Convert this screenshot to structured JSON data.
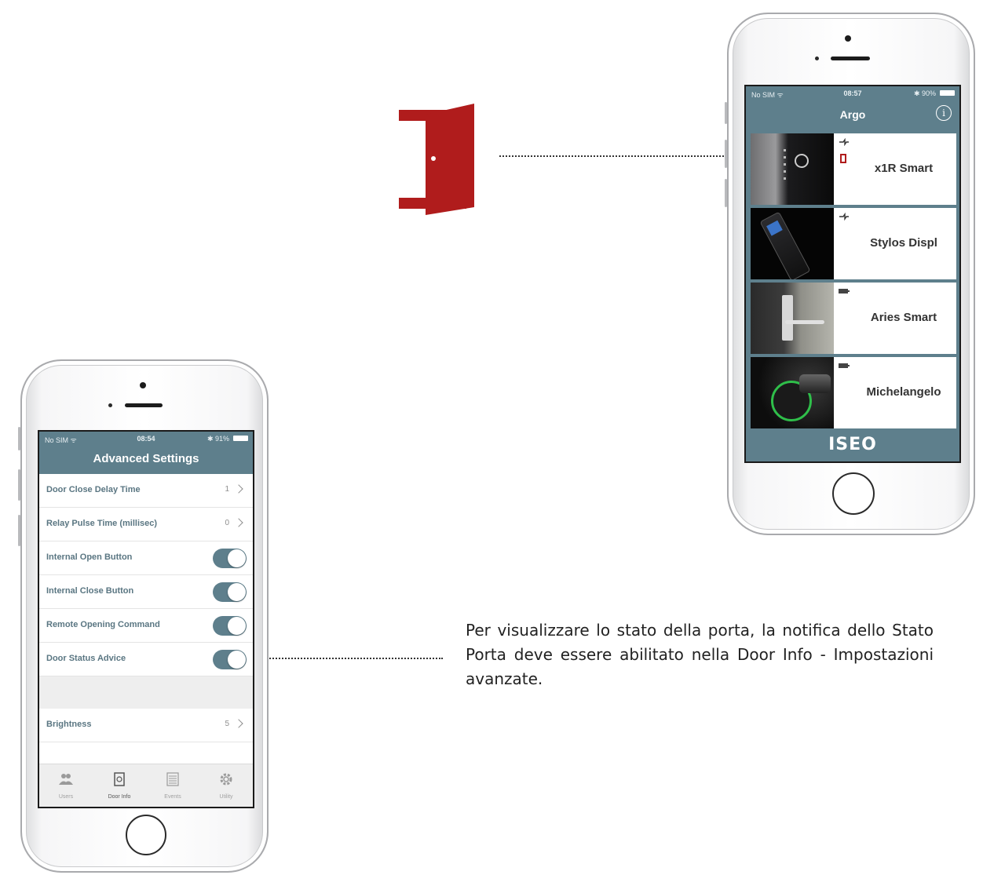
{
  "annotation": {
    "caption": "Per visualizzare lo stato della porta, la notifica dello Stato Porta deve essere abilitato nella Door Info - Impostazioni avanzate.",
    "door_icon": "door-open-icon",
    "door_icon_color": "#b01c1c"
  },
  "left_phone": {
    "status": {
      "carrier": "No SIM ᯤ",
      "time": "08:54",
      "battery": "✱ 91%"
    },
    "title": "Advanced Settings",
    "settings": [
      {
        "label": "Door Close Delay Time",
        "value": "1"
      },
      {
        "label": "Relay Pulse Time (millisec)",
        "value": "0"
      },
      {
        "label": "Internal Open Button",
        "toggle": true
      },
      {
        "label": "Internal Close Button",
        "toggle": true
      },
      {
        "label": "Remote Opening Command",
        "toggle": true
      },
      {
        "label": "Door Status Advice",
        "toggle": true
      }
    ],
    "brightness": {
      "label": "Brightness",
      "value": "5"
    },
    "tabs": [
      {
        "label": "Users",
        "icon": "users-icon"
      },
      {
        "label": "Door Info",
        "icon": "door-info-icon"
      },
      {
        "label": "Events",
        "icon": "events-icon"
      },
      {
        "label": "Utility",
        "icon": "gear-icon"
      }
    ]
  },
  "right_phone": {
    "status": {
      "carrier": "No SIM ᯤ",
      "time": "08:57",
      "battery": "✱ 90%"
    },
    "title": "Argo",
    "devices": [
      {
        "name": "x1R Smart",
        "signal_icon": "plug-icon"
      },
      {
        "name": "Stylos Displ",
        "signal_icon": "plug-icon"
      },
      {
        "name": "Aries Smart",
        "signal_icon": "battery-icon"
      },
      {
        "name": "Michelangelo",
        "signal_icon": "battery-icon"
      }
    ],
    "brand": "ISEO"
  },
  "colors": {
    "accent": "#5e7f8c",
    "label_text": "#5a7682"
  }
}
